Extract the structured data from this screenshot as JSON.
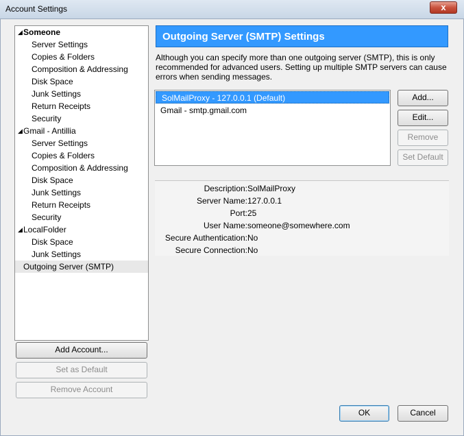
{
  "window": {
    "title": "Account Settings",
    "close_label": "x"
  },
  "tree": {
    "accounts": [
      {
        "name": "Someone",
        "bold": true,
        "items": [
          "Server Settings",
          "Copies & Folders",
          "Composition & Addressing",
          "Disk Space",
          "Junk Settings",
          "Return Receipts",
          "Security"
        ]
      },
      {
        "name": "Gmail - Antillia",
        "bold": false,
        "items": [
          "Server Settings",
          "Copies & Folders",
          "Composition & Addressing",
          "Disk Space",
          "Junk Settings",
          "Return Receipts",
          "Security"
        ]
      },
      {
        "name": "LocalFolder",
        "bold": false,
        "items": [
          "Disk Space",
          "Junk Settings"
        ]
      }
    ],
    "outgoing": "Outgoing Server (SMTP)"
  },
  "left_buttons": {
    "add_account": "Add Account...",
    "set_default": "Set as Default",
    "remove_account": "Remove Account"
  },
  "panel": {
    "header": "Outgoing Server (SMTP) Settings",
    "description": "Although you can specify more than one outgoing server (SMTP), this is only recommended for advanced users. Setting up multiple SMTP servers can cause errors when sending messages.",
    "servers": [
      {
        "label": "SolMailProxy - 127.0.0.1 (Default)",
        "selected": true
      },
      {
        "label": "Gmail - smtp.gmail.com",
        "selected": false
      }
    ],
    "buttons": {
      "add": "Add...",
      "edit": "Edit...",
      "remove": "Remove",
      "set_default": "Set Default"
    },
    "details": [
      {
        "label": "Description:",
        "value": "SolMailProxy"
      },
      {
        "label": "Server Name:",
        "value": "127.0.0.1"
      },
      {
        "label": "Port:",
        "value": "25"
      },
      {
        "label": "User Name:",
        "value": "someone@somewhere.com"
      },
      {
        "label": "Secure Authentication:",
        "value": "No"
      },
      {
        "label": "Secure Connection:",
        "value": "No"
      }
    ]
  },
  "footer": {
    "ok": "OK",
    "cancel": "Cancel"
  }
}
